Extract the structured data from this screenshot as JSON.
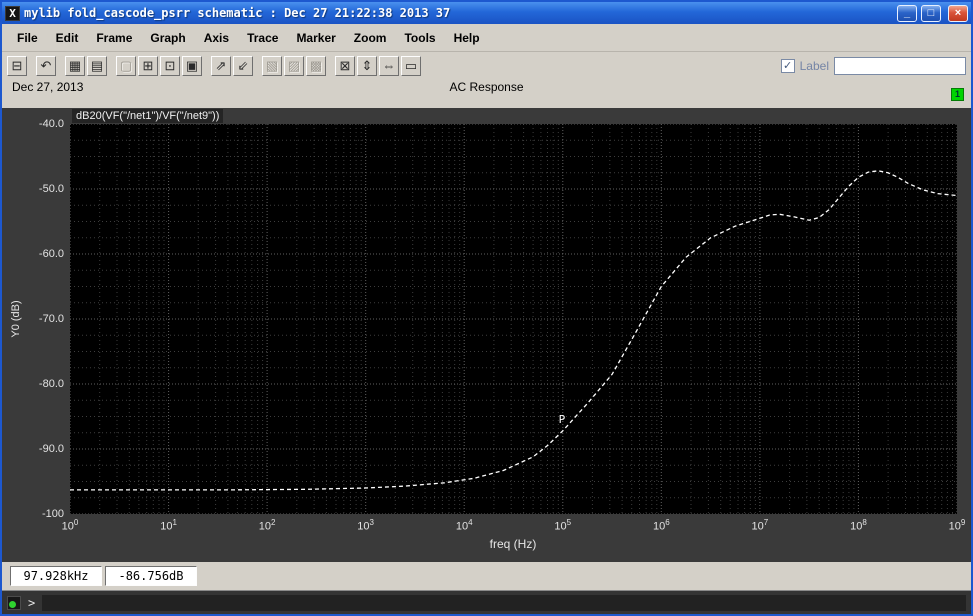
{
  "window": {
    "icon_glyph": "X",
    "title": "mylib fold_cascode_psrr schematic : Dec 27 21:22:38 2013 37",
    "buttons": {
      "minimize": "_",
      "maximize": "□",
      "close": "×"
    }
  },
  "menu": {
    "items": [
      "File",
      "Edit",
      "Frame",
      "Graph",
      "Axis",
      "Trace",
      "Marker",
      "Zoom",
      "Tools",
      "Help"
    ]
  },
  "toolbar": {
    "icons": [
      {
        "name": "print-icon",
        "glyph": "⊟",
        "enabled": true,
        "gap": true
      },
      {
        "name": "undo-icon",
        "glyph": "↶",
        "enabled": true,
        "gap": true
      },
      {
        "name": "major-grid-icon",
        "glyph": "▦",
        "enabled": true,
        "gap": false
      },
      {
        "name": "minor-grid-icon",
        "glyph": "▤",
        "enabled": true,
        "gap": true
      },
      {
        "name": "subwindow-icon",
        "glyph": "▢",
        "enabled": false,
        "gap": false
      },
      {
        "name": "add-subwindow-icon",
        "glyph": "⊞",
        "enabled": true,
        "gap": false
      },
      {
        "name": "copy-window-icon",
        "glyph": "⊡",
        "enabled": true,
        "gap": false
      },
      {
        "name": "paste-window-icon",
        "glyph": "▣",
        "enabled": true,
        "gap": true
      },
      {
        "name": "raise-window-icon",
        "glyph": "⇗",
        "enabled": true,
        "gap": false
      },
      {
        "name": "lower-window-icon",
        "glyph": "⇙",
        "enabled": true,
        "gap": true
      },
      {
        "name": "cut-trace-icon",
        "glyph": "▧",
        "enabled": false,
        "gap": false
      },
      {
        "name": "copy-trace-icon",
        "glyph": "▨",
        "enabled": false,
        "gap": false
      },
      {
        "name": "delete-trace-icon",
        "glyph": "▩",
        "enabled": false,
        "gap": true
      },
      {
        "name": "zoom-fit-icon",
        "glyph": "⊠",
        "enabled": true,
        "gap": false
      },
      {
        "name": "zoom-y-icon",
        "glyph": "⇕",
        "enabled": true,
        "gap": false
      },
      {
        "name": "zoom-x-icon",
        "glyph": "⇔",
        "enabled": true,
        "gap": false
      },
      {
        "name": "zoom-box-icon",
        "glyph": "▭",
        "enabled": true,
        "gap": false
      }
    ],
    "label_checkbox": {
      "checked": true,
      "glyph": "✓",
      "label": "Label"
    },
    "label_input": {
      "value": ""
    }
  },
  "header": {
    "date": "Dec 27, 2013",
    "title": "AC Response",
    "page_badge": "1"
  },
  "plot": {
    "signal_label": "dB20(VF(\"/net1\")/VF(\"/net9\"))",
    "y_axis_label": "Y0 (dB)",
    "x_axis_label": "freq (Hz)",
    "x_tick_base": "10"
  },
  "readouts": {
    "x_value": "97.928kHz",
    "y_value": "-86.756dB"
  },
  "command": {
    "prompt": ">"
  },
  "chart_data": {
    "type": "line",
    "title": "AC Response",
    "xlabel": "freq (Hz)",
    "ylabel": "Y0 (dB)",
    "x_scale": "log",
    "xlim_log10": [
      0,
      9
    ],
    "ylim": [
      -100,
      -40
    ],
    "grid": "on",
    "y_major_ticks": [
      -40,
      -50,
      -60,
      -70,
      -80,
      -90,
      -100
    ],
    "y_tick_labels": [
      "-40.0",
      "-50.0",
      "-60.0",
      "-70.0",
      "-80.0",
      "-90.0",
      "-100"
    ],
    "x_tick_exponents": [
      0,
      1,
      2,
      3,
      4,
      5,
      6,
      7,
      8,
      9
    ],
    "series": [
      {
        "name": "dB20(VF(\"/net1\")/VF(\"/net9\"))",
        "color": "#ffffff",
        "style": "dashed",
        "points_log10x_y": [
          [
            0,
            -96.3
          ],
          [
            0.8,
            -96.3
          ],
          [
            1.6,
            -96.3
          ],
          [
            2.4,
            -96.2
          ],
          [
            3.0,
            -96.0
          ],
          [
            3.4,
            -95.7
          ],
          [
            3.8,
            -95.2
          ],
          [
            4.1,
            -94.5
          ],
          [
            4.4,
            -93.3
          ],
          [
            4.7,
            -91.2
          ],
          [
            4.85,
            -89.4
          ],
          [
            5.0,
            -87.2
          ],
          [
            5.25,
            -83.0
          ],
          [
            5.5,
            -78.5
          ],
          [
            5.75,
            -71.8
          ],
          [
            6.0,
            -65.0
          ],
          [
            6.25,
            -60.5
          ],
          [
            6.5,
            -57.5
          ],
          [
            6.75,
            -55.7
          ],
          [
            7.0,
            -54.5
          ],
          [
            7.1,
            -54.0
          ],
          [
            7.2,
            -53.9
          ],
          [
            7.35,
            -54.3
          ],
          [
            7.5,
            -54.8
          ],
          [
            7.6,
            -54.4
          ],
          [
            7.7,
            -53.2
          ],
          [
            7.8,
            -51.4
          ],
          [
            7.9,
            -49.6
          ],
          [
            8.0,
            -48.2
          ],
          [
            8.1,
            -47.4
          ],
          [
            8.2,
            -47.2
          ],
          [
            8.3,
            -47.5
          ],
          [
            8.4,
            -48.2
          ],
          [
            8.5,
            -49.1
          ],
          [
            8.65,
            -50.1
          ],
          [
            8.8,
            -50.7
          ],
          [
            9.0,
            -51.0
          ]
        ]
      }
    ],
    "marker": {
      "label": "P",
      "x_log10": 4.991,
      "y": -86.756,
      "freq_text": "97.928kHz",
      "value_text": "-86.756dB"
    }
  }
}
